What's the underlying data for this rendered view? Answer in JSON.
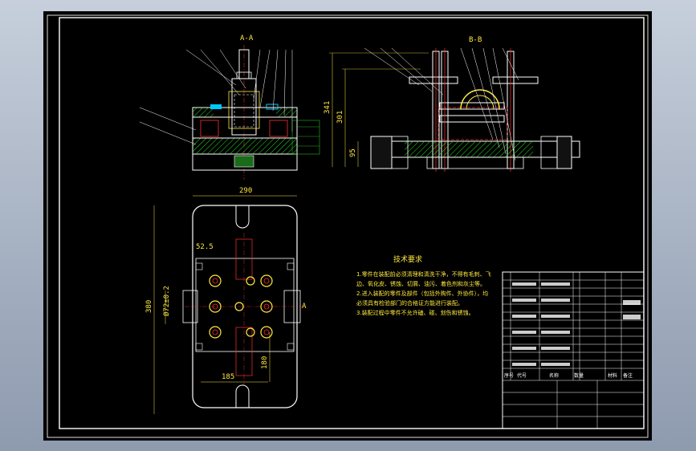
{
  "section_labels": {
    "a_a": "A-A",
    "b_b": "B-B",
    "a_marker": "A"
  },
  "dimensions": {
    "top_width": "290",
    "left_height": "380",
    "width_52_5": "52.5",
    "dia": "Ø72±0.2",
    "bottom_185": "185",
    "right_180": "180",
    "bb_341": "341",
    "bb_301": "301",
    "bb_95": "95"
  },
  "tech": {
    "title": "技术要求",
    "lines": [
      "1.零件在装配前必须清理和清洗干净，不得有毛刺、飞",
      "边、氧化皮、锈蚀、切屑、油污、着色剂和灰尘等。",
      "2.进入装配的零件及部件（包括外购件、外协件），均",
      "必须具有检验部门的合格证方能进行装配。",
      "3.装配过程中零件不允许磕、碰、划伤和锈蚀。"
    ]
  },
  "title_block": {
    "header": [
      "序号",
      "代号",
      "名称",
      "数量",
      "材料",
      "备注"
    ]
  },
  "colors": {
    "background": "#000000",
    "frame": "#ffffff",
    "dim": "#ffe93f",
    "part": "#00ffff",
    "hidden": "#ff3030",
    "green": "#27e027"
  }
}
